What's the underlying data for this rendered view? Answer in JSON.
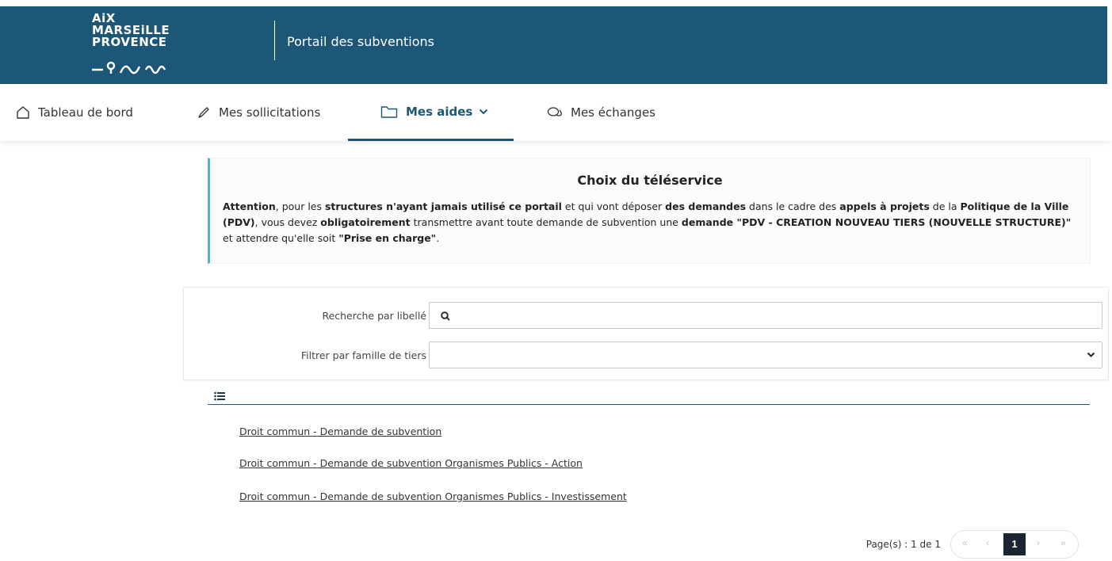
{
  "header": {
    "logo_lines": [
      "AiX",
      "MARSEiLLE",
      "PROVENCE"
    ],
    "portal_title": "Portail des subventions"
  },
  "nav": {
    "items": [
      {
        "label": "Tableau de bord",
        "icon": "home-icon"
      },
      {
        "label": "Mes sollicitations",
        "icon": "pen-icon"
      },
      {
        "label": "Mes aides",
        "icon": "folder-icon",
        "active": true
      },
      {
        "label": "Mes échanges",
        "icon": "chat-icon"
      }
    ],
    "accent_color": "#1c5777"
  },
  "alert": {
    "title": "Choix du téléservice",
    "segments": [
      {
        "t": "Attention",
        "b": true
      },
      {
        "t": ", pour les ",
        "b": false
      },
      {
        "t": "structures n'ayant jamais utilisé ce portail",
        "b": true
      },
      {
        "t": " et qui vont déposer ",
        "b": false
      },
      {
        "t": "des demandes",
        "b": true
      },
      {
        "t": " dans le cadre des ",
        "b": false
      },
      {
        "t": "appels à projets",
        "b": true
      },
      {
        "t": " de la ",
        "b": false
      },
      {
        "t": "Politique de la Ville (PDV)",
        "b": true
      },
      {
        "t": ", vous devez ",
        "b": false
      },
      {
        "t": "obligatoirement",
        "b": true
      },
      {
        "t": " transmettre avant toute demande de subvention une ",
        "b": false
      },
      {
        "t": "demande \"PDV - CREATION NOUVEAU TIERS (NOUVELLE STRUCTURE)\"",
        "b": true
      },
      {
        "t": " et attendre qu'elle soit ",
        "b": false
      },
      {
        "t": "\"Prise en charge\"",
        "b": true
      },
      {
        "t": ".",
        "b": false
      }
    ]
  },
  "filters": {
    "search_label": "Recherche par libellé",
    "search_value": "",
    "family_label": "Filtrer par famille de tiers",
    "family_value": ""
  },
  "list": {
    "items": [
      "Droit commun - Demande de subvention",
      "Droit commun - Demande de subvention Organismes Publics - Action",
      "Droit commun - Demande de subvention Organismes Publics - Investissement"
    ]
  },
  "pagination": {
    "info": "Page(s) : 1 de 1",
    "first": "«",
    "prev": "‹",
    "current": "1",
    "next": "›",
    "last": "»"
  }
}
